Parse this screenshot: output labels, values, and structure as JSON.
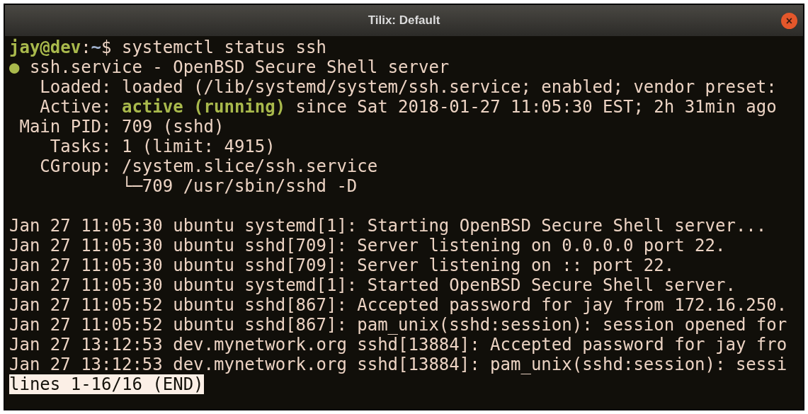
{
  "window": {
    "title": "Tilix: Default",
    "close_label": "×"
  },
  "terminal": {
    "status_lines": [
      {
        "segments": [
          {
            "kind": "user_host",
            "text": "jay@dev"
          },
          {
            "kind": "plain",
            "text": ":"
          },
          {
            "kind": "path",
            "text": "~"
          },
          {
            "kind": "plain",
            "text": "$ systemctl status ssh"
          }
        ]
      },
      {
        "segments": [
          {
            "kind": "dot",
            "text": "●"
          },
          {
            "kind": "plain",
            "text": " ssh.service - OpenBSD Secure Shell server"
          }
        ]
      },
      {
        "segments": [
          {
            "kind": "plain",
            "text": "   Loaded: loaded (/lib/systemd/system/ssh.service; enabled; vendor preset:"
          }
        ]
      },
      {
        "segments": [
          {
            "kind": "plain",
            "text": "   Active: "
          },
          {
            "kind": "active",
            "text": "active (running)"
          },
          {
            "kind": "plain",
            "text": " since Sat 2018-01-27 11:05:30 EST; 2h 31min ago"
          }
        ]
      },
      {
        "segments": [
          {
            "kind": "plain",
            "text": " Main PID: 709 (sshd)"
          }
        ]
      },
      {
        "segments": [
          {
            "kind": "plain",
            "text": "    Tasks: 1 (limit: 4915)"
          }
        ]
      },
      {
        "segments": [
          {
            "kind": "plain",
            "text": "   CGroup: /system.slice/ssh.service"
          }
        ]
      },
      {
        "segments": [
          {
            "kind": "plain",
            "text": "           └─709 /usr/sbin/sshd -D"
          }
        ]
      }
    ],
    "journal_lines": [
      "Jan 27 11:05:30 ubuntu systemd[1]: Starting OpenBSD Secure Shell server...",
      "Jan 27 11:05:30 ubuntu sshd[709]: Server listening on 0.0.0.0 port 22.",
      "Jan 27 11:05:30 ubuntu sshd[709]: Server listening on :: port 22.",
      "Jan 27 11:05:30 ubuntu systemd[1]: Started OpenBSD Secure Shell server.",
      "Jan 27 11:05:52 ubuntu sshd[867]: Accepted password for jay from 172.16.250.",
      "Jan 27 11:05:52 ubuntu sshd[867]: pam_unix(sshd:session): session opened for",
      "Jan 27 13:12:53 dev.mynetwork.org sshd[13884]: Accepted password for jay fro",
      "Jan 27 13:12:53 dev.mynetwork.org sshd[13884]: pam_unix(sshd:session): sessi"
    ],
    "pager_status": "lines 1-16/16 (END)"
  }
}
